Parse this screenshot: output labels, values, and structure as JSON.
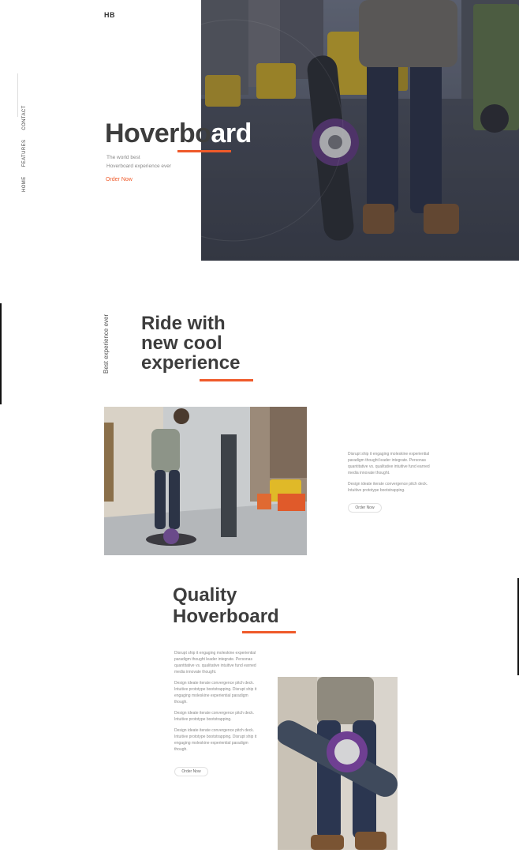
{
  "brand": {
    "logo": "HB"
  },
  "nav": {
    "items": [
      "HOME",
      "FEATURES",
      "CONTACT"
    ]
  },
  "hero": {
    "title_main": "Hoverbo",
    "title_tail": "ard",
    "subtitle_line1": "The world best",
    "subtitle_line2": "Hoverboard experience ever",
    "cta": "Order Now",
    "image_alt": "person-holding-hoverboard-street-photo"
  },
  "section_ride": {
    "vertical_label": "Best experience ever",
    "title_line1": "Ride with",
    "title_line2": "new cool",
    "title_line3": "experience",
    "paragraph1": "Disrupt ship it engaging moleskine experiential paradigm thought leader integrate. Personas quantitative vs. qualitative intuitive fund earned media innovate thought.",
    "paragraph2": "Design ideate iterate convergence pitch deck. Intuitive prototype bootstrapping.",
    "button": "Order Now",
    "image_alt": "man-riding-hoverboard-city-sidewalk-photo"
  },
  "section_quality": {
    "title_line1": "Quality",
    "title_line2": "Hoverboard",
    "paragraph1": "Disrupt ship it engaging moleskine experiential paradigm thought leader integrate. Personas quantitative vs. qualitative intuitive fund earned media innovate thought.",
    "paragraph2": "Design ideate iterate convergence pitch deck. Intuitive prototype bootstrapping. Disrupt ship it engaging moleskine experiential paradigm though.",
    "paragraph3": "Design ideate iterate convergence pitch deck. Intuitive prototype bootstrapping.",
    "paragraph4": "Design ideate iterate convergence pitch deck. Intuitive prototype bootstrapping. Disrupt ship it engaging moleskine experiential paradigm though.",
    "button": "Order Now",
    "image_alt": "hand-carrying-hoverboard-photo"
  },
  "colors": {
    "accent": "#ef5a2a",
    "text_dark": "#3d3d3d",
    "text_muted": "#8a8a8a"
  }
}
